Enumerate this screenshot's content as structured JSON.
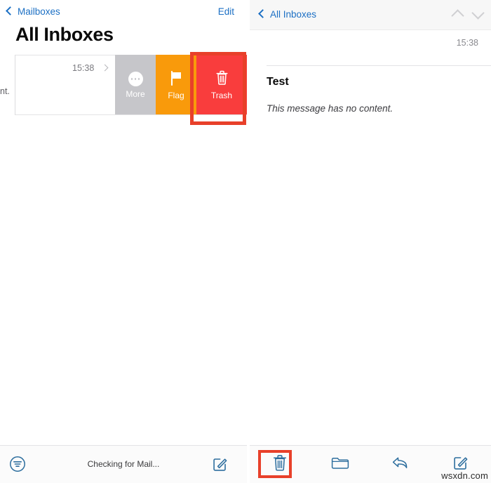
{
  "left_panel": {
    "nav": {
      "back_label": "Mailboxes",
      "back_icon": "chevron-left-icon",
      "edit_label": "Edit"
    },
    "title": "All Inboxes",
    "row": {
      "clipped_preview": "nt.",
      "time": "15:38",
      "disclosure_icon": "chevron-right-icon"
    },
    "swipe_actions": [
      {
        "label": "More",
        "icon": "ellipsis-circle-icon",
        "color": "#c6c6ca"
      },
      {
        "label": "Flag",
        "icon": "flag-icon",
        "color": "#f99a0b"
      },
      {
        "label": "Trash",
        "icon": "trash-icon",
        "color": "#f93d3d"
      }
    ],
    "toolbar": {
      "filter_icon": "filter-circle-icon",
      "status": "Checking for Mail...",
      "compose_icon": "compose-icon"
    }
  },
  "right_panel": {
    "nav": {
      "back_label": "All Inboxes",
      "back_icon": "chevron-left-icon",
      "prev_icon": "chevron-up-icon",
      "next_icon": "chevron-down-icon"
    },
    "message": {
      "time": "15:38",
      "subject": "Test",
      "body": "This message has no content."
    },
    "toolbar": {
      "items": [
        {
          "icon": "trash-icon",
          "name": "delete-message-button"
        },
        {
          "icon": "folder-icon",
          "name": "move-message-button"
        },
        {
          "icon": "reply-arrow-icon",
          "name": "reply-button"
        },
        {
          "icon": "compose-icon",
          "name": "compose-button"
        }
      ]
    }
  },
  "annotations": {
    "highlight_color": "#e8402a",
    "trash_swipe_highlight": "Trash",
    "trash_toolbar_highlight": "trash-icon"
  },
  "watermark": "wsxdn.com"
}
